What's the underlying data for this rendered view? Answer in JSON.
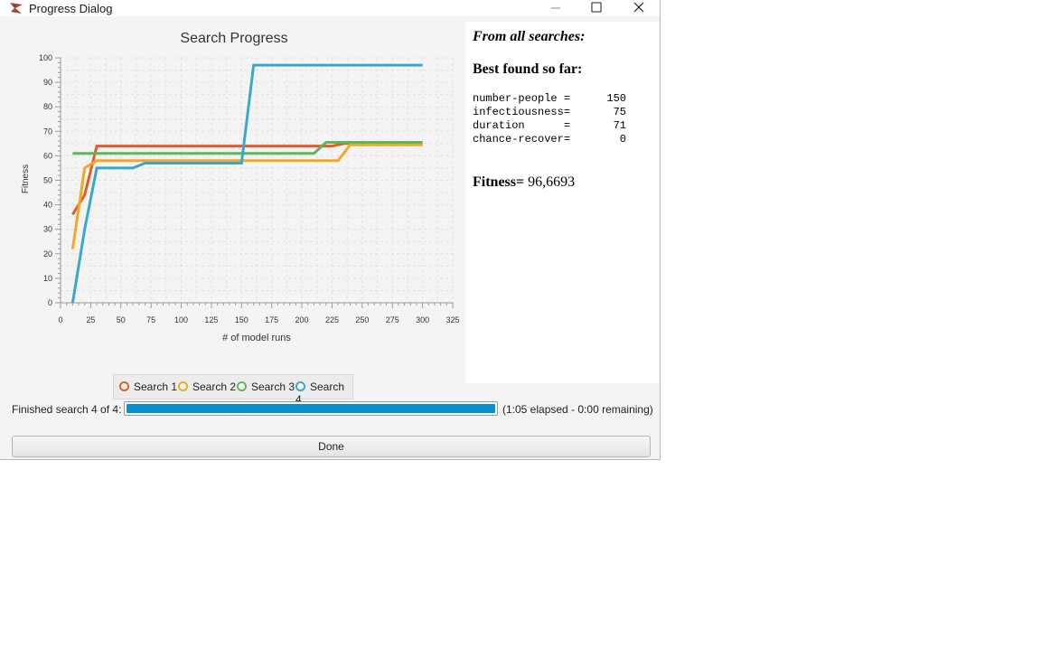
{
  "window": {
    "title": "Progress Dialog",
    "minimize_icon": "minimize-icon",
    "maximize_icon": "maximize-icon",
    "close_icon": "close-icon"
  },
  "chart_data": {
    "type": "line",
    "title": "Search Progress",
    "xlabel": "# of model runs",
    "ylabel": "Fitness",
    "xlim": [
      0,
      325
    ],
    "ylim": [
      0,
      100
    ],
    "x_ticks": [
      "0",
      "25",
      "50",
      "75",
      "100",
      "125",
      "150",
      "175",
      "200",
      "225",
      "250",
      "275",
      "300",
      "325"
    ],
    "y_ticks": [
      "0",
      "10",
      "20",
      "30",
      "40",
      "50",
      "60",
      "70",
      "80",
      "90",
      "100"
    ],
    "grid": true,
    "legend_position": "bottom",
    "series": [
      {
        "name": "Search 1",
        "color": "#e45b2a",
        "x": [
          10,
          20,
          30,
          215,
          225,
          235,
          300
        ],
        "y": [
          36,
          44,
          64,
          64,
          64,
          65,
          65
        ]
      },
      {
        "name": "Search 2",
        "color": "#f5a623",
        "x": [
          10,
          20,
          30,
          230,
          240,
          300
        ],
        "y": [
          22,
          55,
          58,
          58,
          64.5,
          64.5
        ]
      },
      {
        "name": "Search 3",
        "color": "#5cb85c",
        "x": [
          10,
          210,
          220,
          300
        ],
        "y": [
          61,
          61,
          65.5,
          65.5
        ]
      },
      {
        "name": "Search 4",
        "color": "#3aa7cf",
        "x": [
          10,
          20,
          30,
          60,
          70,
          150,
          160,
          300
        ],
        "y": [
          0,
          30,
          55,
          55,
          57,
          57,
          97,
          97
        ]
      }
    ]
  },
  "results": {
    "heading": "From all searches:",
    "best_label": "Best found so far:",
    "params": [
      {
        "name": "number-people =",
        "value": "150"
      },
      {
        "name": "infectiousness=",
        "value": "75"
      },
      {
        "name": "duration      =",
        "value": "71"
      },
      {
        "name": "chance-recover=",
        "value": "0"
      }
    ],
    "fitness_label": "Fitness=",
    "fitness_value": "96,6693"
  },
  "status": {
    "label": "Finished search 4 of 4:",
    "progress": 1.0,
    "time_text": "(1:05 elapsed - 0:00 remaining)"
  },
  "done_label": "Done"
}
